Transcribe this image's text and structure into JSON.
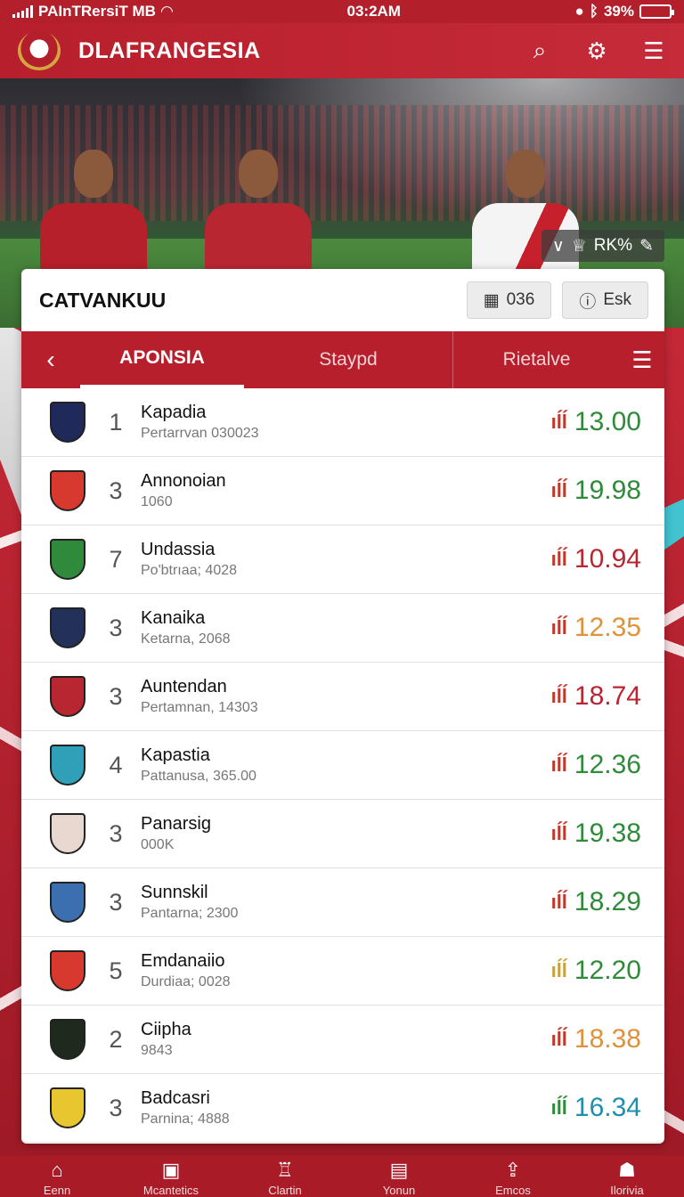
{
  "status_bar": {
    "carrier": "PAInTRersiT MB",
    "time": "03:2AM",
    "battery": "39%",
    "battery_level": 0.39
  },
  "header": {
    "title": "DLAFRANGESIA",
    "icons": [
      "search-icon",
      "settings-icon",
      "menu-icon"
    ]
  },
  "hero": {
    "badge_text": "RK%"
  },
  "card": {
    "title": "CATVANKUU",
    "action_1_label": "036",
    "action_2_label": "Esk"
  },
  "tabs": [
    {
      "label": "APONSIA",
      "active": true
    },
    {
      "label": "Staypd",
      "active": false
    },
    {
      "label": "Rietalve",
      "active": false
    }
  ],
  "rows": [
    {
      "rank": "1",
      "name": "Kapadia",
      "sub": "Pertarrvan 030023",
      "score": "13.00",
      "color": "#2e8b3a",
      "icon_color": "#c0392b",
      "crest": "#1f2a5a"
    },
    {
      "rank": "3",
      "name": "Annonoian",
      "sub": "1060",
      "score": "19.98",
      "color": "#2e8b3a",
      "icon_color": "#c0392b",
      "crest": "#d8392e"
    },
    {
      "rank": "7",
      "name": "Undassia",
      "sub": "Po'btrıaa; 4028",
      "score": "10.94",
      "color": "#b82632",
      "icon_color": "#c0392b",
      "crest": "#2f8a3c"
    },
    {
      "rank": "3",
      "name": "Kanaika",
      "sub": "Ketarna, 2068",
      "score": "12.35",
      "color": "#e0913a",
      "icon_color": "#c0392b",
      "crest": "#22305a"
    },
    {
      "rank": "3",
      "name": "Auntendan",
      "sub": "Pertamnan, 14303",
      "score": "18.74",
      "color": "#b82632",
      "icon_color": "#c0392b",
      "crest": "#b82632"
    },
    {
      "rank": "4",
      "name": "Kapastia",
      "sub": "Pattanusa, 365.00",
      "score": "12.36",
      "color": "#2e8b3a",
      "icon_color": "#c0392b",
      "crest": "#2fa0b8"
    },
    {
      "rank": "3",
      "name": "Panarsig",
      "sub": "000K",
      "score": "19.38",
      "color": "#2e8b3a",
      "icon_color": "#c0392b",
      "crest": "#e8d8d0"
    },
    {
      "rank": "3",
      "name": "Sunnskil",
      "sub": "Pantarna; 2300",
      "score": "18.29",
      "color": "#2e8b3a",
      "icon_color": "#c0392b",
      "crest": "#3c6fb0"
    },
    {
      "rank": "5",
      "name": "Emdanaiio",
      "sub": "Durdiaa; 0028",
      "score": "12.20",
      "color": "#2e8b3a",
      "icon_color": "#c9a13a",
      "crest": "#d8392e"
    },
    {
      "rank": "2",
      "name": "Ciipha",
      "sub": "9843",
      "score": "18.38",
      "color": "#e0913a",
      "icon_color": "#c0392b",
      "crest": "#1e2a1e"
    },
    {
      "rank": "3",
      "name": "Badcasri",
      "sub": "Parnina; 4888",
      "score": "16.34",
      "color": "#1f8fb0",
      "icon_color": "#2e8b3a",
      "crest": "#e8c630"
    }
  ],
  "bottom_nav": [
    {
      "label": "Eenn",
      "icon": "home-icon"
    },
    {
      "label": "Mcantetics",
      "icon": "calendar-icon"
    },
    {
      "label": "Clartin",
      "icon": "trophy-icon"
    },
    {
      "label": "Yonun",
      "icon": "news-icon"
    },
    {
      "label": "Emcos",
      "icon": "share-icon"
    },
    {
      "label": "Ilorivia",
      "icon": "profile-icon"
    }
  ]
}
